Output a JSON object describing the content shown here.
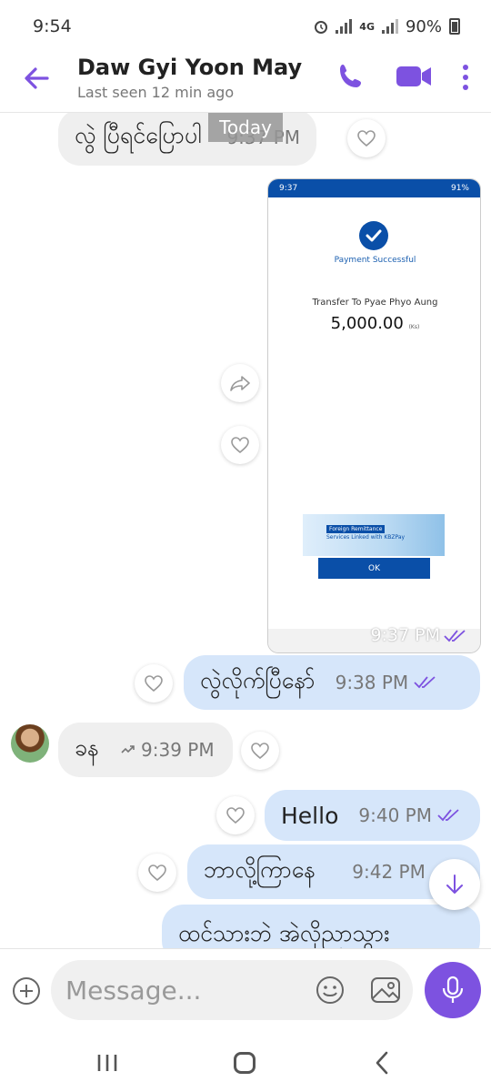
{
  "status_bar": {
    "time": "9:54",
    "network": "4G",
    "battery": "90%"
  },
  "header": {
    "contact_name": "Daw Gyi Yoon May",
    "last_seen": "Last seen 12 min ago"
  },
  "chat": {
    "date_label": "Today",
    "messages": [
      {
        "direction": "incoming",
        "text": "လွဲ ပြီရင်ပြောပါ",
        "time": "9:37 PM"
      },
      {
        "direction": "outgoing",
        "type": "image",
        "time": "9:37 PM"
      },
      {
        "direction": "outgoing",
        "text": "လွဲလိုက်ပြီနော်",
        "time": "9:38 PM"
      },
      {
        "direction": "incoming",
        "text": "ခန",
        "time": "9:39 PM"
      },
      {
        "direction": "outgoing",
        "text": "Hello",
        "time": "9:40 PM"
      },
      {
        "direction": "outgoing",
        "text": "ဘာလို့ကြာနေ",
        "time": "9:42 PM"
      },
      {
        "direction": "outgoing",
        "text": "ထင်သားဘဲ အဲလိုညာသွား"
      }
    ],
    "screenshot": {
      "status_time": "9:37",
      "status_battery": "91%",
      "payment_status": "Payment Successful",
      "transfer_to": "Transfer To Pyae Phyo Aung",
      "amount": "5,000.00",
      "currency": "(Ks)",
      "banner_title": "Foreign Remittance",
      "banner_subtitle": "Services Linked with KBZPay",
      "ok_label": "OK"
    }
  },
  "composer": {
    "placeholder": "Message..."
  },
  "colors": {
    "accent": "#7d52e0",
    "outgoing_bubble": "#d6e6fa",
    "incoming_bubble": "#efefef",
    "kbz_blue": "#0a4fa8"
  }
}
